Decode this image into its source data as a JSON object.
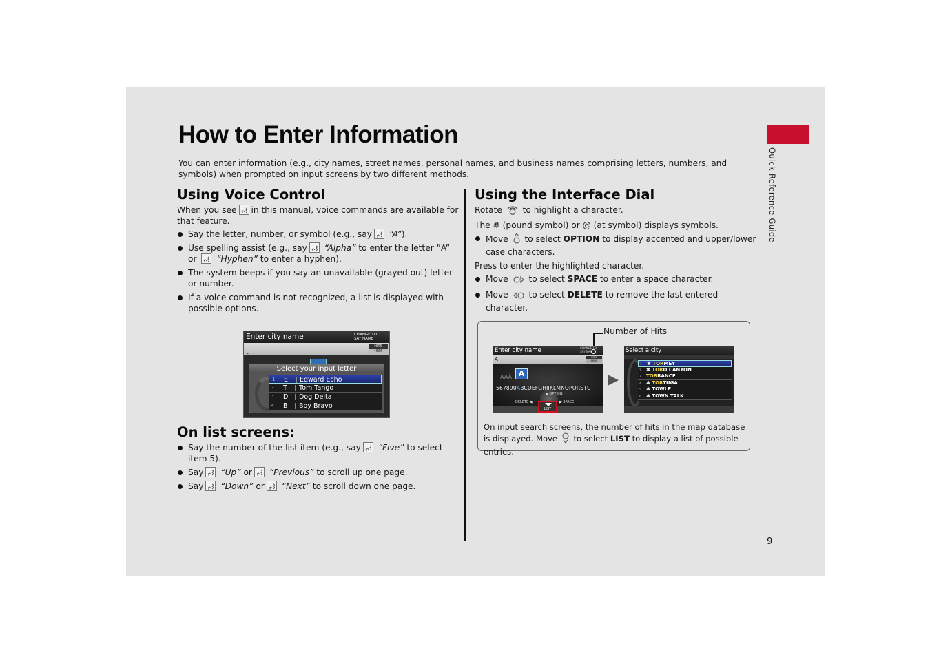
{
  "title": "How to Enter Information",
  "intro": "You can enter information (e.g., city names, street names, personal names, and business names comprising letters, numbers, and symbols) when prompted on input screens by two different methods.",
  "side_tab": {
    "label": "Quick Reference Guide",
    "color": "#c8102e"
  },
  "page_number": "9",
  "voice": {
    "heading": "Using Voice Control",
    "intro_a": "When you see",
    "intro_b": "in this manual, voice commands are available for that feature.",
    "bullets": [
      {
        "a": "Say the letter, number, or symbol (e.g., say",
        "q": "“A”",
        "b": ")."
      },
      {
        "a": "Use spelling assist (e.g., say",
        "q": "“Alpha”",
        "b": "to enter the letter ”A” or",
        "q2": "“Hyphen”",
        "c": "to enter a hyphen)."
      },
      {
        "a": "The system beeps if you say an unavailable (grayed out) letter or number."
      },
      {
        "a": "If a voice command is not recognized, a list is displayed with possible options."
      }
    ],
    "screen": {
      "header": "Enter city name",
      "change_line1": "CHANGE TO",
      "change_line2": "SAY NAME",
      "input_value": "-",
      "hits_label": "HITS",
      "hits_value": "4686",
      "dialog_title": "Select your input letter",
      "rows": [
        {
          "num": "1",
          "letter": "E",
          "word": "Edward Echo"
        },
        {
          "num": "2",
          "letter": "T",
          "word": "Tom Tango"
        },
        {
          "num": "3",
          "letter": "D",
          "word": "Dog Delta"
        },
        {
          "num": "4",
          "letter": "B",
          "word": "Boy Bravo"
        }
      ]
    }
  },
  "list_screens": {
    "heading": "On list screens:",
    "bullets": [
      {
        "a": "Say the number of the list item (e.g., say",
        "q": "“Five”",
        "b": "to select item 5)."
      },
      {
        "a": "Say",
        "q": "“Up”",
        "b": "or",
        "q2": "“Previous”",
        "c": "to scroll up one page."
      },
      {
        "a": "Say",
        "q": "“Down”",
        "b": "or",
        "q2": "“Next”",
        "c": "to scroll down one page."
      }
    ]
  },
  "dial": {
    "heading": "Using the Interface Dial",
    "rotate_a": "Rotate",
    "rotate_b": "to highlight a character.",
    "symbols": "The # (pound symbol) or @ (at symbol) displays symbols.",
    "option_bullet": {
      "a": "Move",
      "b": "to select",
      "bold": "OPTION",
      "c": "to display accented and upper/lower case characters."
    },
    "press": "Press to enter the highlighted character.",
    "space_bullet": {
      "a": "Move",
      "b": "to select",
      "bold": "SPACE",
      "c": "to enter a space character."
    },
    "delete_bullet": {
      "a": "Move",
      "b": "to select",
      "bold": "DELETE",
      "c": "to remove the last entered character."
    }
  },
  "callout": {
    "hits_label": "Number of Hits",
    "input_screen": {
      "header": "Enter city name",
      "change_line1": "CHANGE TO",
      "change_line2": "SAY NAME",
      "input_value": "A_",
      "hits_label": "HITS",
      "hits_value": "4686",
      "highlight_letter": "A",
      "aaa": "ÀÁÂ",
      "alpha_before": "567890",
      "alpha_hl": "A",
      "alpha_after": "BCDEFGHIJKLMNOPQRSTU",
      "option_label": "▲ OPTION",
      "delete_label": "DELETE ◀",
      "space_label": "▶ SPACE",
      "list_label": "LIST"
    },
    "list_screen": {
      "header": "Select a city",
      "rows": [
        {
          "num": "1",
          "star": "✱",
          "hl": "TOR",
          "rest": "MEY"
        },
        {
          "num": "2",
          "star": "✱",
          "hl": "TOR",
          "rest": "O CANYON"
        },
        {
          "num": "3",
          "star": "",
          "hl": "TOR",
          "rest": "RANCE"
        },
        {
          "num": "4",
          "star": "✱",
          "hl": "TOR",
          "rest": "TUGA"
        },
        {
          "num": "5",
          "star": "✱",
          "hl": "",
          "rest": "TOWLE"
        },
        {
          "num": "6",
          "star": "✱",
          "hl": "",
          "rest": "TOWN TALK"
        }
      ]
    },
    "text_a": "On input search screens, the number of hits in the map database is displayed. Move",
    "text_b": "to select",
    "text_bold": "LIST",
    "text_c": "to display a list of possible entries."
  }
}
